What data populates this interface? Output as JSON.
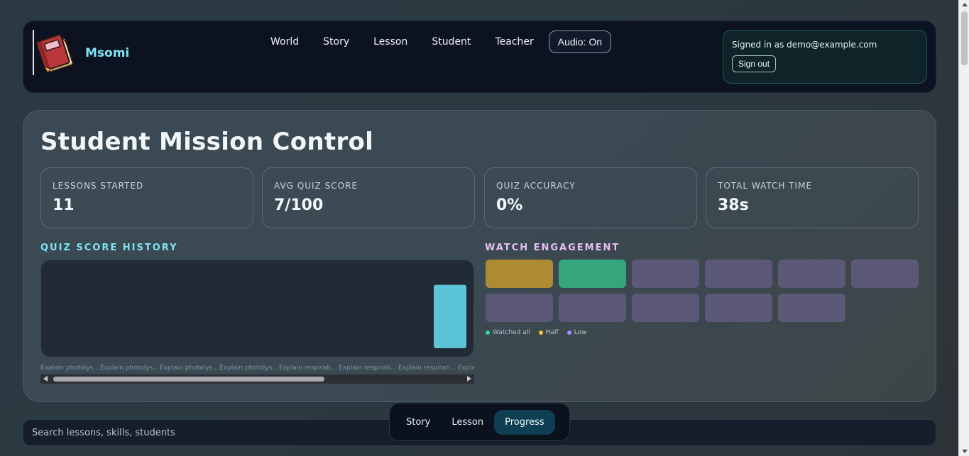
{
  "header": {
    "brand_name": "Msomi",
    "logo_icon": "book-icon",
    "nav": [
      "World",
      "Story",
      "Lesson",
      "Student",
      "Teacher"
    ],
    "audio_label": "Audio: On",
    "signed_in_text": "Signed in as demo@example.com",
    "sign_out_label": "Sign out"
  },
  "main": {
    "title": "Student Mission Control",
    "stats": [
      {
        "label": "LESSONS STARTED",
        "value": "11"
      },
      {
        "label": "AVG QUIZ SCORE",
        "value": "7/100"
      },
      {
        "label": "QUIZ ACCURACY",
        "value": "0%"
      },
      {
        "label": "TOTAL WATCH TIME",
        "value": "38s"
      }
    ],
    "quiz_history_label": "QUIZ SCORE HISTORY",
    "watch_engagement_label": "WATCH ENGAGEMENT",
    "watch_tiles": [
      "half",
      "watched",
      "low",
      "low",
      "low",
      "low",
      "low",
      "low",
      "low",
      "low",
      "low"
    ],
    "legend": [
      {
        "label": "Watched all",
        "color": "#34d399"
      },
      {
        "label": "Half",
        "color": "#fbbf24"
      },
      {
        "label": "Low",
        "color": "#a78bfa"
      }
    ],
    "tile_colors": {
      "half": "#ad8b33",
      "watched": "#35a67c",
      "low": "#5c5878"
    }
  },
  "chart_data": {
    "type": "bar",
    "title": "QUIZ SCORE HISTORY",
    "categories": [
      "Explain photolys...",
      "Explain photolys...",
      "Explain photolys...",
      "Explain photolys...",
      "Explain respirati...",
      "Explain respirati...",
      "Explain respirati...",
      "Expla"
    ],
    "values": [
      0,
      0,
      0,
      0,
      0,
      0,
      0,
      77
    ],
    "ylim": [
      0,
      100
    ],
    "bar_color": "#5bc4d6",
    "grid": false
  },
  "search": {
    "placeholder": "Search lessons, skills, students"
  },
  "bottom_tabs": {
    "items": [
      "Story",
      "Lesson",
      "Progress"
    ],
    "active": "Progress"
  }
}
